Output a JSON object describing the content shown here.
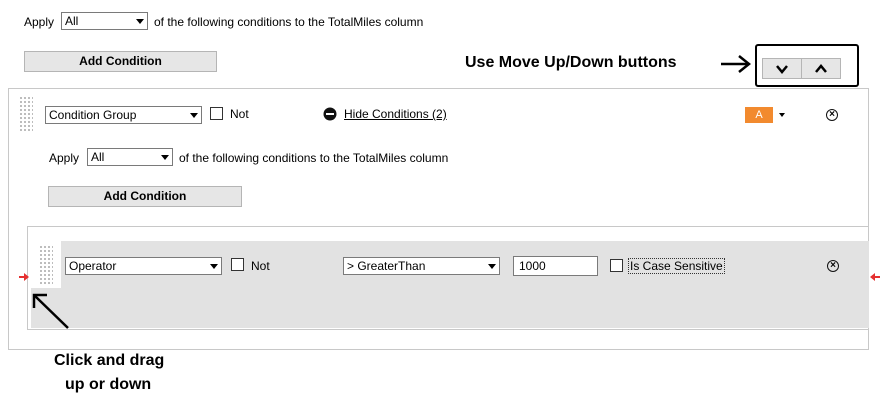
{
  "top": {
    "apply_label": "Apply",
    "apply_value": "All",
    "suffix": "of the following conditions to the TotalMiles column",
    "add_condition": "Add Condition"
  },
  "group": {
    "type_value": "Condition Group",
    "not_label": "Not",
    "hide_conditions": "Hide Conditions (2)",
    "badge": "A",
    "apply_label": "Apply",
    "apply_value": "All",
    "suffix": "of the following conditions to the TotalMiles column",
    "add_condition": "Add Condition"
  },
  "condition": {
    "type_value": "Operator",
    "not_label": "Not",
    "operator_value": "> GreaterThan",
    "value": "1000",
    "case_sensitive": "Is Case Sensitive"
  },
  "annotations": {
    "move_buttons": "Use Move Up/Down buttons",
    "drag_line1": "Click and drag",
    "drag_line2": "up or down"
  },
  "icons": {
    "move_down": "chevron-down-icon",
    "move_up": "chevron-up-icon",
    "hide": "minus-circle-icon",
    "remove": "close-circle-icon",
    "drag": "drag-handle-icon"
  },
  "colors": {
    "badge": "#f28a2e",
    "panel": "#e2e2e2",
    "marker": "#e53030"
  }
}
